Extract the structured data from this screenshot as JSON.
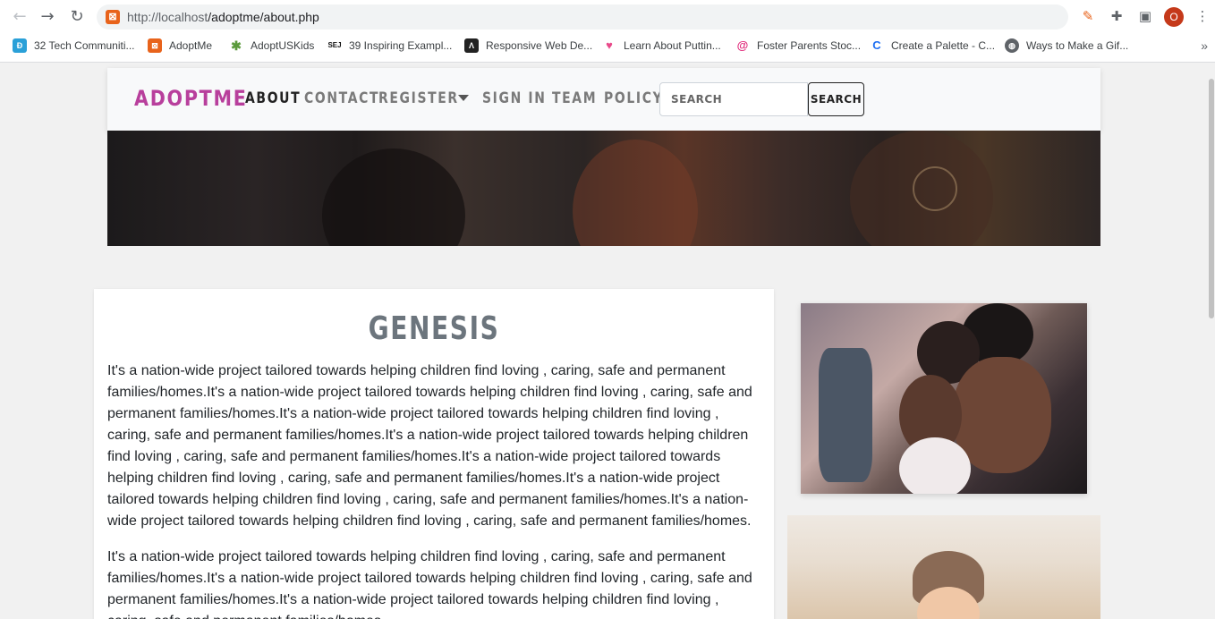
{
  "browser": {
    "url_host": "http://localhost",
    "url_path": "/adoptme/about.php",
    "profile_initial": "O"
  },
  "bookmarks": [
    {
      "label": "32 Tech Communiti...",
      "icon": "tech-icon",
      "color": "#2aa0d8"
    },
    {
      "label": "AdoptMe",
      "icon": "xampp-icon",
      "color": "#e8631b"
    },
    {
      "label": "AdoptUSKids",
      "icon": "adoptuskids-icon",
      "color": "#5a9a3c"
    },
    {
      "label": "39 Inspiring Exampl...",
      "icon": "sej-icon",
      "color": "#111111"
    },
    {
      "label": "Responsive Web De...",
      "icon": "webflow-icon",
      "color": "#222222"
    },
    {
      "label": "Learn About Puttin...",
      "icon": "heart-icon",
      "color": "#e84a8a"
    },
    {
      "label": "Foster Parents Stoc...",
      "icon": "spiral-icon",
      "color": "#e0297a"
    },
    {
      "label": "Create a Palette - C...",
      "icon": "coolors-icon",
      "color": "#1e6ff2"
    },
    {
      "label": "Ways to Make a Gif...",
      "icon": "globe-icon",
      "color": "#5f6368"
    }
  ],
  "site": {
    "brand": "ADOPTME",
    "nav": {
      "about": "ABOUT",
      "contact": "CONTACT",
      "register": "REGISTER",
      "sign_in": "SIGN IN",
      "team": "TEAM",
      "policy": "POLICY"
    },
    "search_placeholder": "SEARCH",
    "search_button": "SEARCH"
  },
  "content": {
    "heading": "GENESIS",
    "paragraph1": "It's a nation-wide project tailored towards helping children find loving , caring, safe and permanent families/homes.It's a nation-wide project tailored towards helping children find loving , caring, safe and permanent families/homes.It's a nation-wide project tailored towards helping children find loving , caring, safe and permanent families/homes.It's a nation-wide project tailored towards helping children find loving , caring, safe and permanent families/homes.It's a nation-wide project tailored towards helping children find loving , caring, safe and permanent families/homes.It's a nation-wide project tailored towards helping children find loving , caring, safe and permanent families/homes.It's a nation-wide project tailored towards helping children find loving , caring, safe and permanent families/homes.",
    "paragraph2": "It's a nation-wide project tailored towards helping children find loving , caring, safe and permanent families/homes.It's a nation-wide project tailored towards helping children find loving , caring, safe and permanent families/homes.It's a nation-wide project tailored towards helping children find loving , caring, safe and permanent families/homes."
  }
}
